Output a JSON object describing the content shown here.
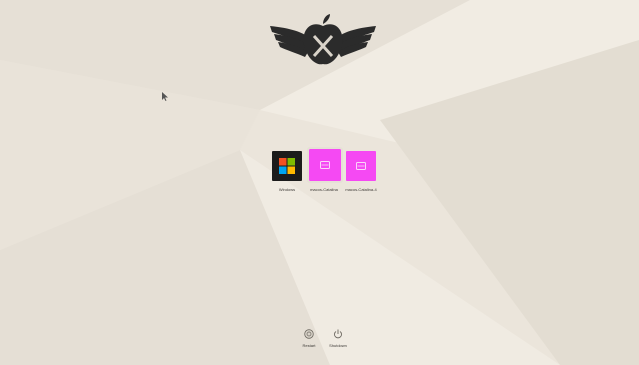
{
  "boot_menu": {
    "tiles": [
      {
        "label": "Windows",
        "icon": "windows-logo-icon",
        "color": "#1b1b1b"
      },
      {
        "label": "macos-Catalina",
        "icon": "hard-drive-icon",
        "color": "#f549f3"
      },
      {
        "label": "macos-Catalina-4",
        "icon": "hard-drive-icon",
        "color": "#f549f3"
      }
    ],
    "footer": {
      "restart_label": "Restart",
      "shutdown_label": "Shutdown"
    }
  },
  "colors": {
    "background": "#ece6dc",
    "accent_tile": "#f549f3",
    "logo": "#2b2b2b"
  }
}
